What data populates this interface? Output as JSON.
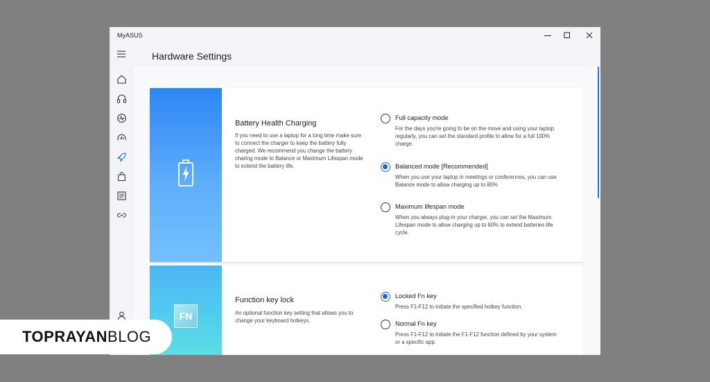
{
  "app": {
    "title": "MyASUS"
  },
  "window_controls": [
    {
      "icon": "minimize-icon"
    },
    {
      "icon": "maximize-icon"
    },
    {
      "icon": "close-icon"
    }
  ],
  "sidebar": {
    "items": [
      {
        "icon": "hamburger-menu-icon"
      },
      {
        "icon": "home-icon"
      },
      {
        "icon": "headset-icon"
      },
      {
        "icon": "diagnostics-icon"
      },
      {
        "icon": "system-performance-icon"
      },
      {
        "icon": "rocket-icon",
        "active": true
      },
      {
        "icon": "shopping-bag-icon"
      },
      {
        "icon": "news-icon"
      },
      {
        "icon": "link-icon"
      },
      {
        "icon": "user-icon"
      }
    ]
  },
  "page": {
    "title": "Hardware Settings"
  },
  "battery": {
    "title": "Battery Health Charging",
    "description": "If you need to use a laptop for a long time make sure to connect the charger to keep the battery fully charged. We recommend you change the battery charing mode to Balance or Maximum Lifespan mode to extend the battery life.",
    "icon": "battery-charging-icon",
    "options": [
      {
        "label": "Full capacity mode",
        "description": "For the days you're going to be on the move and using your laptop regularly, you can set the standard profile to allow for a full 100% charge.",
        "selected": false
      },
      {
        "label": "Balanced mode [Recommended]",
        "description": "When you use your laptop in meetings or conferences, you can use Balance mode to allow charging up to 80%",
        "selected": true
      },
      {
        "label": "Maximum lifespan mode",
        "description": "When you always plug-in your charger, you can set the Maximum Lifespan mode to allow charging up to 60% to extend batteries life cycle.",
        "selected": false
      }
    ]
  },
  "fnlock": {
    "title": "Function key lock",
    "description": "An optional function key setting that allows you to change your keyboard hotkeys.",
    "icon_text": "FN",
    "options": [
      {
        "label": "Locked Fn key",
        "description": "Press F1-F12 to initiate the specified hotkey function.",
        "selected": true
      },
      {
        "label": "Normal Fn key",
        "description": "Press F1-F12 to initiate the F1-F12 function defined by your system or a specific app.",
        "selected": false
      }
    ]
  },
  "watermark": {
    "bold": "TOPRAYAN",
    "light": "BLOG"
  },
  "colors": {
    "accent": "#1a66d9",
    "background": "#808080"
  }
}
